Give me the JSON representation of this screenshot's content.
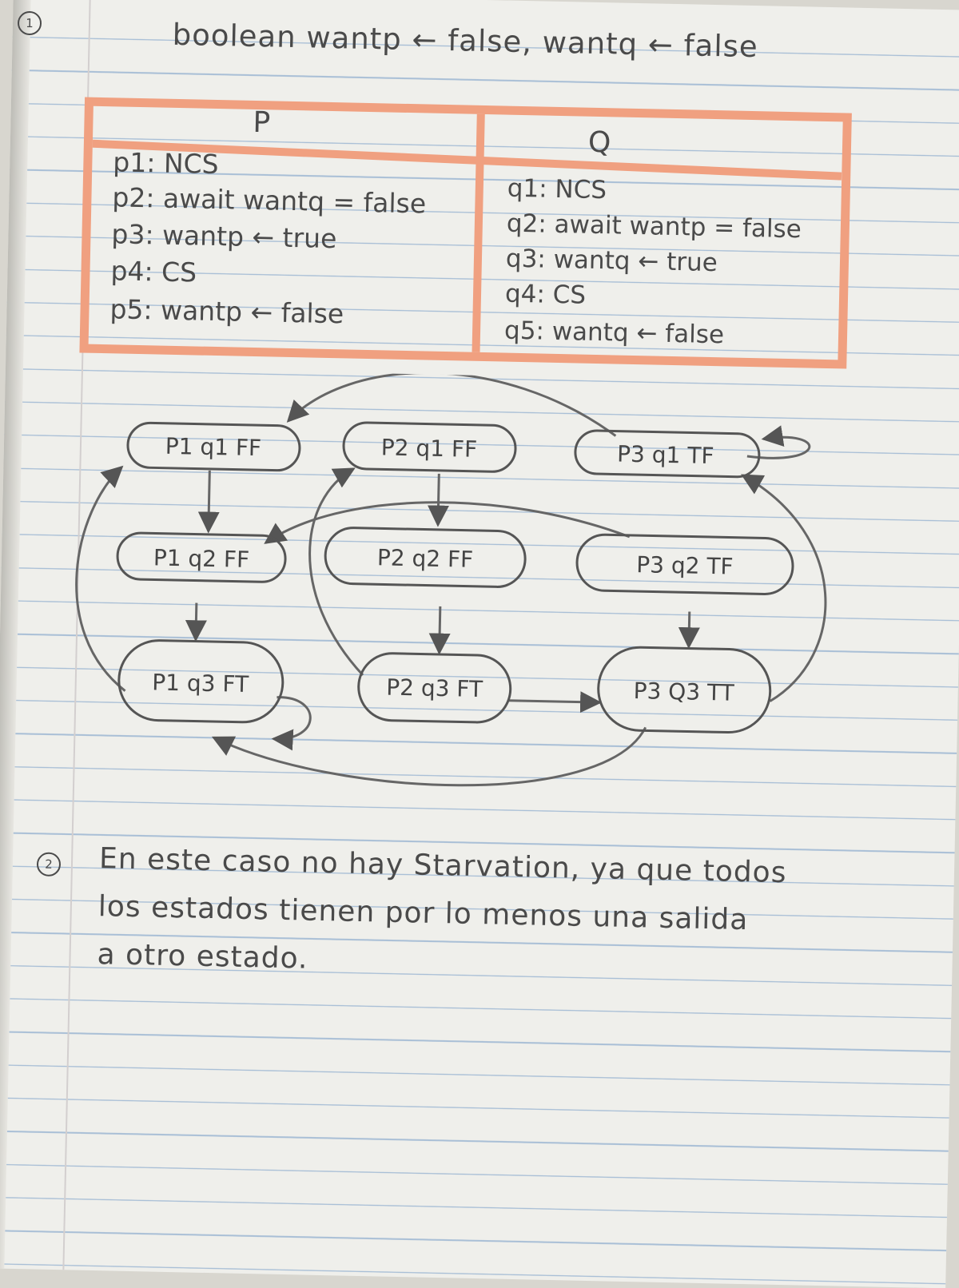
{
  "exercise_1_number": "1",
  "header": "boolean wantp ← false, wantq ← false",
  "table": {
    "p_title": "P",
    "q_title": "Q",
    "p_lines": [
      "p1: NCS",
      "p2: await wantq = false",
      "p3: wantp ← true",
      "p4: CS",
      "p5: wantp ← false"
    ],
    "q_lines": [
      "q1: NCS",
      "q2: await wantp = false",
      "q3: wantq ← true",
      "q4: CS",
      "q5: wantq ← false"
    ]
  },
  "states": [
    {
      "id": "s_p1q1",
      "label": "P1 q1 FF"
    },
    {
      "id": "s_p2q1",
      "label": "P2 q1 FF"
    },
    {
      "id": "s_p3q1",
      "label": "P3 q1 TF"
    },
    {
      "id": "s_p1q2",
      "label": "P1 q2 FF"
    },
    {
      "id": "s_p2q2",
      "label": "P2 q2 FF"
    },
    {
      "id": "s_p3q2",
      "label": "P3 q2 TF"
    },
    {
      "id": "s_p1q3",
      "label": "P1 q3 FT"
    },
    {
      "id": "s_p2q3",
      "label": "P2 q3 FT"
    },
    {
      "id": "s_p3q3",
      "label": "P3 Q3 TT"
    }
  ],
  "exercise_2_number": "2",
  "answer_lines": [
    "En este caso no hay Starvation, ya que todos",
    "los estados tienen por lo menos una salida",
    "a otro estado."
  ]
}
